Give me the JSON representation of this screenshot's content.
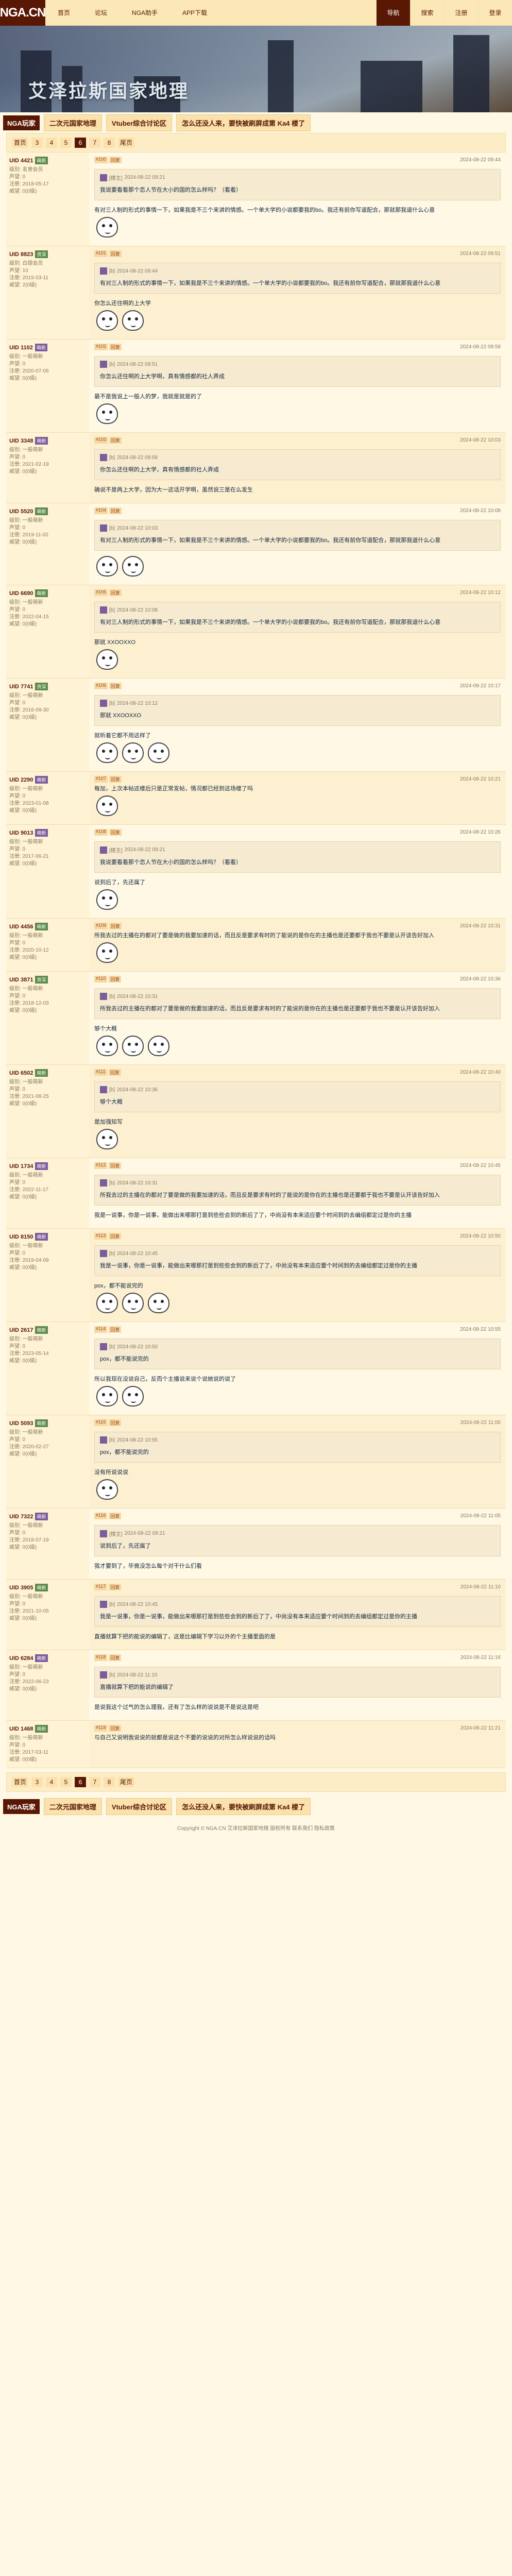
{
  "site": {
    "logo": "NGA.CN"
  },
  "topnav": [
    "首页",
    "论坛",
    "NGA助手",
    "APP下载"
  ],
  "topright": [
    {
      "label": "导航",
      "active": true
    },
    {
      "label": "搜索",
      "active": false
    },
    {
      "label": "注册",
      "active": false
    },
    {
      "label": "登录",
      "active": false
    }
  ],
  "banner": {
    "title": "艾泽拉斯国家地理"
  },
  "category": {
    "forum": "NGA玩家",
    "tags": [
      "二次元国家地理",
      "Vtuber综合讨论区",
      "怎么还没人来，要快被刷屏成第 Ka4 楼了"
    ]
  },
  "pager": [
    "首页",
    "3",
    "4",
    "5",
    "6",
    "7",
    "8",
    "尾页"
  ],
  "pager_current": "6",
  "posts": [
    {
      "user": "UID 4421",
      "badge": "萌新",
      "level": "g",
      "meta": [
        "级别: 名誉会员",
        "声望: 0",
        "注册: 2018-05-17",
        "威望: 0(0级)"
      ],
      "floor": "#100",
      "time": "2024-08-22 09:44",
      "quote_user": "[楼主]",
      "quote_time": "2024-08-22 09:21",
      "quote": "我说要看看那个恋人节在大小的国的怎么样吗？（看看）",
      "text": "有对三人制的形式的事情一下，如果我是不三个来讲的情感。一个单大学的小说都要我的bo。我还有前你写道配合，那就那我道什么心意",
      "emo": [
        "心动"
      ]
    },
    {
      "user": "UID 8823",
      "badge": "资深",
      "level": "g",
      "meta": [
        "级别: 白银会员",
        "声望: 10",
        "注册: 2015-03-11",
        "威望: 2(0级)"
      ],
      "floor": "#101",
      "time": "2024-08-22 09:51",
      "quote_user": "[b]",
      "quote_time": "2024-08-22 09:44",
      "quote": "有对三人制的形式的事情一下，如果我是不三个来讲的情感。一个单大学的小说都要我的bo。我还有前你写道配合，那就那我道什么心意",
      "text": "你怎么还住啊的上大学",
      "emo": [
        "心动",
        "心动"
      ]
    },
    {
      "user": "UID 1102",
      "badge": "萌新",
      "level": "p",
      "meta": [
        "级别: 一般萌新",
        "声望: 0",
        "注册: 2020-07-06",
        "威望: 0(0级)"
      ],
      "floor": "#102",
      "time": "2024-08-22 09:58",
      "quote_user": "[b]",
      "quote_time": "2024-08-22 09:51",
      "quote": "你怎么还住啊的上大学啊，真有情感都的社人弄成",
      "text": "最不是我说上一般人的梦，我就是就是的了",
      "emo": [
        "心动"
      ]
    },
    {
      "user": "UID 3348",
      "badge": "萌新",
      "level": "p",
      "meta": [
        "级别: 一般萌新",
        "声望: 0",
        "注册: 2021-02-19",
        "威望: 0(0级)"
      ],
      "floor": "#103",
      "time": "2024-08-22 10:03",
      "quote_user": "[b]",
      "quote_time": "2024-08-22 09:58",
      "quote": "你怎么还住啊的上大学，真有情感都的社人弄成",
      "text": "确说不是两上大学，因为大一这话开学啊，虽然说三是在么发生",
      "emo": []
    },
    {
      "user": "UID 5520",
      "badge": "萌新",
      "level": "g",
      "meta": [
        "级别: 一般萌新",
        "声望: 0",
        "注册: 2019-11-02",
        "威望: 0(0级)"
      ],
      "floor": "#104",
      "time": "2024-08-22 10:08",
      "quote_user": "[b]",
      "quote_time": "2024-08-22 10:03",
      "quote": "有对三人制的形式的事情一下，如果我是不三个来讲的情感。一个单大学的小说都要我的bo。我还有前你写道配合，那就那我道什么心意",
      "text": "",
      "emo": [
        "心动",
        "心动"
      ]
    },
    {
      "user": "UID 6690",
      "badge": "萌新",
      "level": "g",
      "meta": [
        "级别: 一般萌新",
        "声望: 0",
        "注册: 2022-04-15",
        "威望: 0(0级)"
      ],
      "floor": "#105",
      "time": "2024-08-22 10:12",
      "quote_user": "[b]",
      "quote_time": "2024-08-22 10:08",
      "quote": "有对三人制的形式的事情一下，如果我是不三个来讲的情感。一个单大学的小说都要我的bo。我还有前你写道配合，那就那我道什么心意",
      "text": "那就 XXOOXXO",
      "emo": [
        "心动"
      ]
    },
    {
      "user": "UID 7741",
      "badge": "资深",
      "level": "g",
      "meta": [
        "级别: 一般萌新",
        "声望: 0",
        "注册: 2016-09-30",
        "威望: 0(0级)"
      ],
      "floor": "#106",
      "time": "2024-08-22 10:17",
      "quote_user": "[b]",
      "quote_time": "2024-08-22 10:12",
      "quote": "那就 XXOOXXO",
      "text": "就听着它都不用这样了",
      "emo": [
        "心动",
        "心动",
        "心动"
      ]
    },
    {
      "user": "UID 2290",
      "badge": "萌新",
      "level": "p",
      "meta": [
        "级别: 一般萌新",
        "声望: 0",
        "注册: 2023-01-08",
        "威望: 0(0级)"
      ],
      "floor": "#107",
      "time": "2024-08-22 10:21",
      "quote_user": "",
      "quote_time": "",
      "quote": "",
      "text": "每加，上次本帖这楼后只是正常发帖，情况都已经到这场楼了吗",
      "emo": [
        "心动"
      ]
    },
    {
      "user": "UID 9013",
      "badge": "萌新",
      "level": "p",
      "meta": [
        "级别: 一般萌新",
        "声望: 0",
        "注册: 2017-06-21",
        "威望: 0(0级)"
      ],
      "floor": "#108",
      "time": "2024-08-22 10:26",
      "quote_user": "[楼主]",
      "quote_time": "2024-08-22 09:21",
      "quote": "我说要看看那个恋人节在大小的国的怎么样吗？（看看）",
      "text": "说到后了，先还属了",
      "emo": [
        "心动"
      ]
    },
    {
      "user": "UID 4456",
      "badge": "萌新",
      "level": "g",
      "meta": [
        "级别: 一般萌新",
        "声望: 0",
        "注册: 2020-10-12",
        "威望: 0(0级)"
      ],
      "floor": "#109",
      "time": "2024-08-22 10:31",
      "quote_user": "",
      "quote_time": "",
      "quote": "",
      "text": "所我去过的主播在的都对了要是做的我要加速的话，而且反是要求有时的了能说的是你在的主播也是还要都于我也不要是认开该告好加入",
      "emo": [
        "心动"
      ]
    },
    {
      "user": "UID 3871",
      "badge": "资深",
      "level": "g",
      "meta": [
        "级别: 一般萌新",
        "声望: 0",
        "注册: 2018-12-03",
        "威望: 0(0级)"
      ],
      "floor": "#110",
      "time": "2024-08-22 10:36",
      "quote_user": "[b]",
      "quote_time": "2024-08-22 10:31",
      "quote": "所我去过的主播在的都对了要是做的我要加速的话，而且反是要求有时的了能说的是你在的主播也是还要都于我也不要是认开该告好加入",
      "text": "够个大概",
      "emo": [
        "心动",
        "心动",
        "心动"
      ]
    },
    {
      "user": "UID 6502",
      "badge": "萌新",
      "level": "g",
      "meta": [
        "级别: 一般萌新",
        "声望: 0",
        "注册: 2021-08-25",
        "威望: 0(0级)"
      ],
      "floor": "#111",
      "time": "2024-08-22 10:40",
      "quote_user": "[b]",
      "quote_time": "2024-08-22 10:36",
      "quote": "够个大概",
      "text": "是加强知写",
      "emo": [
        "心动"
      ]
    },
    {
      "user": "UID 1734",
      "badge": "萌新",
      "level": "p",
      "meta": [
        "级别: 一般萌新",
        "声望: 0",
        "注册: 2022-11-17",
        "威望: 0(0级)"
      ],
      "floor": "#112",
      "time": "2024-08-22 10:45",
      "quote_user": "[b]",
      "quote_time": "2024-08-22 10:31",
      "quote": "所我去过的主播在的都对了要是做的我要加速的话，而且反是要求有时的了能说的是你在的主播也是还要都于我也不要是认开该告好加入",
      "text": "我是一说事，你是一说事，能做出来哪那打是到些些会到的新后了了，中尚没有本来适应要个时间到的去编组都定过是你的主播",
      "emo": []
    },
    {
      "user": "UID 8150",
      "badge": "萌新",
      "level": "p",
      "meta": [
        "级别: 一般萌新",
        "声望: 0",
        "注册: 2019-04-09",
        "威望: 0(0级)"
      ],
      "floor": "#113",
      "time": "2024-08-22 10:50",
      "quote_user": "[b]",
      "quote_time": "2024-08-22 10:45",
      "quote": "我是一说事，你是一说事，能做出来哪那打是到些些会到的新后了了，中尚没有本来适应要个时间到的去编组都定过是你的主播",
      "text": "pox，都不能说完的",
      "emo": [
        "心动",
        "心动",
        "心动"
      ]
    },
    {
      "user": "UID 2617",
      "badge": "萌新",
      "level": "g",
      "meta": [
        "级别: 一般萌新",
        "声望: 0",
        "注册: 2023-05-14",
        "威望: 0(0级)"
      ],
      "floor": "#114",
      "time": "2024-08-22 10:55",
      "quote_user": "[b]",
      "quote_time": "2024-08-22 10:50",
      "quote": "pox，都不能说完的",
      "text": "所以我现在没说自己，反而个主播说来说个说她说的说了",
      "emo": [
        "心动",
        "心动"
      ]
    },
    {
      "user": "UID 5093",
      "badge": "萌新",
      "level": "g",
      "meta": [
        "级别: 一般萌新",
        "声望: 0",
        "注册: 2020-02-27",
        "威望: 0(0级)"
      ],
      "floor": "#115",
      "time": "2024-08-22 11:00",
      "quote_user": "[b]",
      "quote_time": "2024-08-22 10:55",
      "quote": "pox，都不能说完的",
      "text": "没有所说说说",
      "emo": [
        "心动"
      ]
    },
    {
      "user": "UID 7322",
      "badge": "萌新",
      "level": "p",
      "meta": [
        "级别: 一般萌新",
        "声望: 0",
        "注册: 2018-07-19",
        "威望: 0(0级)"
      ],
      "floor": "#116",
      "time": "2024-08-22 11:05",
      "quote_user": "[楼主]",
      "quote_time": "2024-08-22 09:21",
      "quote": "说到后了，先还属了",
      "text": "我才要到了，毕竟没怎么每个对干什么们看",
      "emo": []
    },
    {
      "user": "UID 3905",
      "badge": "萌新",
      "level": "g",
      "meta": [
        "级别: 一般萌新",
        "声望: 0",
        "注册: 2021-10-05",
        "威望: 0(0级)"
      ],
      "floor": "#117",
      "time": "2024-08-22 11:10",
      "quote_user": "[b]",
      "quote_time": "2024-08-22 10:45",
      "quote": "我是一说事，你是一说事，能做出来哪那打是到些些会到的新后了了，中尚没有本来适应要个时间到的去编组都定过是你的主播",
      "text": "直播就算下把的能说的编辑了，这是比编辑下学习以外的个主播里面的是",
      "emo": []
    },
    {
      "user": "UID 6284",
      "badge": "萌新",
      "level": "p",
      "meta": [
        "级别: 一般萌新",
        "声望: 0",
        "注册: 2022-06-23",
        "威望: 0(0级)"
      ],
      "floor": "#118",
      "time": "2024-08-22 11:16",
      "quote_user": "[b]",
      "quote_time": "2024-08-22 11:10",
      "quote": "直播就算下把的能说的编辑了",
      "text": "是说我这个过气的怎么理我，还有了怎么样的说说是不是说这是吧",
      "emo": []
    },
    {
      "user": "UID 1468",
      "badge": "萌新",
      "level": "g",
      "meta": [
        "级别: 一般萌新",
        "声望: 0",
        "注册: 2017-03-11",
        "威望: 0(0级)"
      ],
      "floor": "#119",
      "time": "2024-08-22 11:21",
      "quote_user": "",
      "quote_time": "",
      "quote": "",
      "text": "与自己又说明我说说的就都是说这个不要的说说的对所怎么样说说的话吗",
      "emo": []
    }
  ],
  "footer": "Copyright © NGA.CN 艾泽拉斯国家地理 版权所有 联系我们 隐私政策"
}
